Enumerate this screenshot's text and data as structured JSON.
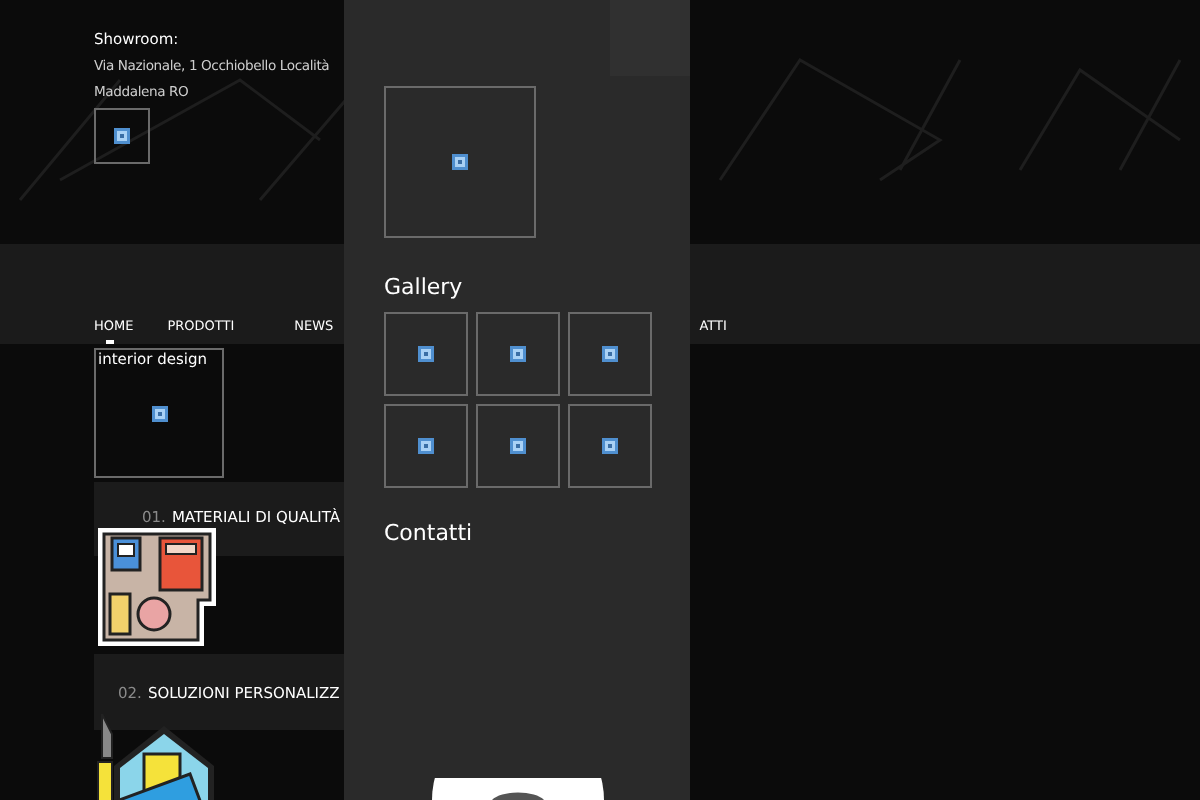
{
  "showroom": {
    "label": "Showroom:",
    "address_lines": [
      "Via Nazionale, 1 Occhiobello Località",
      "Maddalena RO"
    ],
    "image": {
      "kind": "broken-image"
    }
  },
  "nav": [
    {
      "label": "HOME",
      "selected": true
    },
    {
      "label": "PRODOTTI",
      "selected": false
    },
    {
      "label": "NEWS",
      "selected": false
    },
    {
      "label": "ATTI",
      "selected": false
    }
  ],
  "hero_image": {
    "alt": "interior design",
    "kind": "broken-image"
  },
  "features": [
    {
      "number": "01.",
      "title": "MATERIALI DI QUALITÀ",
      "kind": "floor-plan"
    },
    {
      "number": "02.",
      "title": "SOLUZIONI PERSONALIZZ",
      "kind": "house-swatches"
    }
  ],
  "panel": {
    "top_image": {
      "kind": "broken-image"
    },
    "gallery": {
      "title": "Gallery",
      "images": [
        {
          "kind": "broken-image"
        },
        {
          "kind": "broken-image"
        },
        {
          "kind": "broken-image"
        },
        {
          "kind": "broken-image"
        },
        {
          "kind": "broken-image"
        },
        {
          "kind": "broken-image"
        }
      ]
    },
    "contacts": {
      "title": "Contatti"
    }
  }
}
